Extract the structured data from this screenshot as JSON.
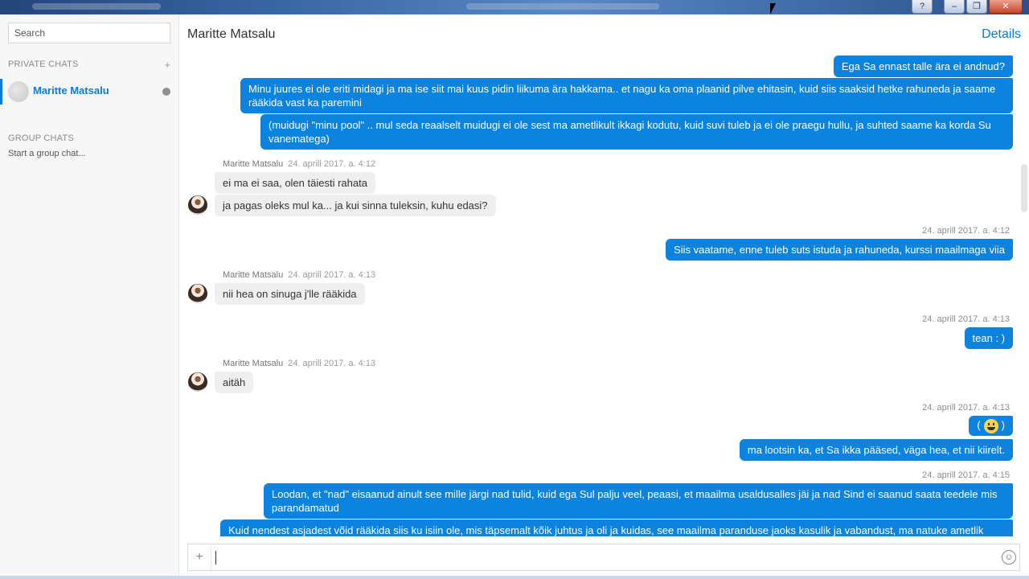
{
  "window": {
    "controls": [
      "?",
      "–",
      "❐",
      "✕"
    ]
  },
  "sidebar": {
    "search_placeholder": "Search",
    "private_title": "PRIVATE CHATS",
    "add_symbol": "+",
    "chats": [
      {
        "name": "Maritte Matsalu"
      }
    ],
    "group_title": "GROUP CHATS",
    "start_group": "Start a group chat..."
  },
  "header": {
    "title": "Maritte Matsalu",
    "details": "Details"
  },
  "messages": {
    "m1": "Ega Sa ennast talle ära ei andnud?",
    "m2": "Minu juures ei ole eriti midagi ja ma ise siit mai kuus pidin liikuma ära hakkama.. et nagu ka oma plaanid pilve ehitasin, kuid siis saaksid hetke rahuneda ja saame rääkida vast ka paremini",
    "m3": "(muidugi \"minu pool\" .. mul seda reaalselt muidugi ei ole sest ma ametlikult ikkagi kodutu, kuid suvi tuleb ja ei ole praegu hullu, ja suhted saame ka korda Su vanematega)",
    "sender": "Maritte Matsalu",
    "t1": "24. aprill 2017. a. 4:12",
    "m4": "ei ma ei saa, olen täiesti rahata",
    "m5": "ja pagas oleks mul ka... ja kui sinna tuleksin, kuhu edasi?",
    "t2": "24. aprill 2017. a. 4:12",
    "m6": "Siis vaatame, enne tuleb suts istuda ja rahuneda, kurssi maailmaga viia",
    "t3": "24. aprill 2017. a. 4:13",
    "m7": "nii hea on sinuga j'lle rääkida",
    "t4": "24. aprill 2017. a. 4:13",
    "m8": "tean : )",
    "t5": "24. aprill 2017. a. 4:13",
    "m9": "aitäh",
    "t6": "24. aprill 2017. a. 4:13",
    "m10a": "(",
    "m10b": ")",
    "m11": "ma lootsin ka, et Sa ikka pääsed, väga hea, et nii kiirelt.",
    "t7": "24. aprill 2017. a. 4:15",
    "m12": "Loodan, et \"nad\" eisaanud ainult see mille järgi nad tulid, kuid ega Sul palju veel, peaasi, et maailma usaldusalles jäi ja nad Sind ei saanud saata teedele mis parandamatud",
    "m13": "Kuid nendest asjadest võid rääkida siis ku isiin ole, mis täpsemalt kõik juhtus ja oli ja kuidas, see maailma paranduse jaoks kasulik ja vabandust, ma natuke ametlik"
  },
  "composer": {
    "add_symbol": "+",
    "value": ""
  },
  "colors": {
    "accent": "#0b83df",
    "incoming": "#efefef"
  }
}
